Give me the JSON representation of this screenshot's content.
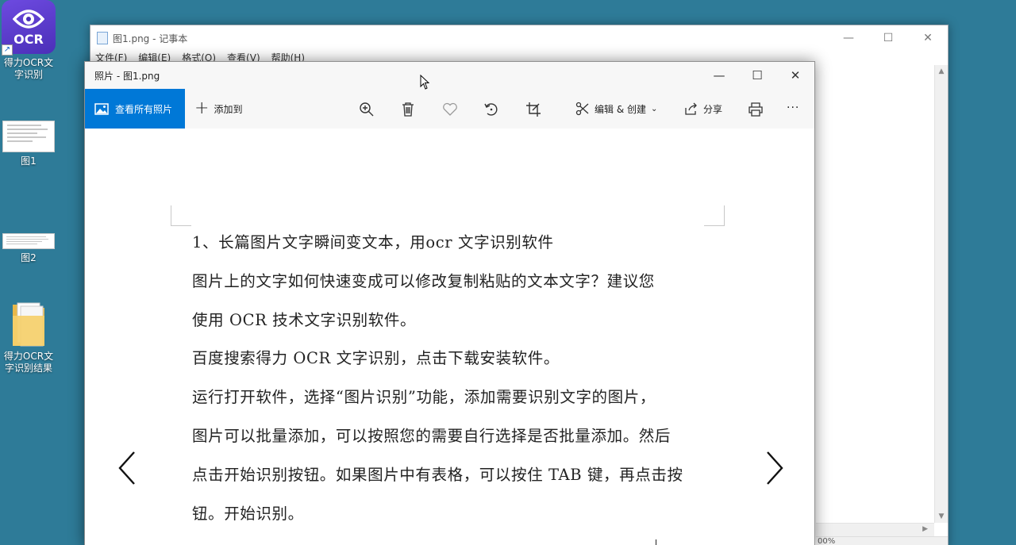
{
  "desktop": {
    "icons": [
      {
        "label_line1": "得力OCR文",
        "label_line2": "字识别",
        "badge": "OCR"
      },
      {
        "label": "图1"
      },
      {
        "label": "图2"
      },
      {
        "label_line1": "得力OCR文",
        "label_line2": "字识别结果"
      }
    ]
  },
  "notepad": {
    "title": "图1.png - 记事本",
    "menu": [
      "文件(F)",
      "编辑(E)",
      "格式(O)",
      "查看(V)",
      "帮助(H)"
    ],
    "status_zoom": "00%"
  },
  "photos": {
    "title": "照片 - 图1.png",
    "toolbar": {
      "view_all": "查看所有照片",
      "add_to": "添加到",
      "edit_create": "编辑 & 创建",
      "share": "分享",
      "more": "···"
    },
    "document_lines": [
      "1、长篇图片文字瞬间变文本，用ocr 文字识别软件",
      "图片上的文字如何快速变成可以修改复制粘贴的文本文字？建议您",
      "使用 OCR 技术文字识别软件。",
      "百度搜索得力 OCR 文字识别，点击下载安装软件。",
      "运行打开软件，选择“图片识别”功能，添加需要识别文字的图片，",
      "图片可以批量添加，可以按照您的需要自行选择是否批量添加。然后",
      "点击开始识别按钮。如果图片中有表格，可以按住 TAB 键，再点击按",
      "钮。开始识别。"
    ]
  },
  "colors": {
    "desktop": "#2e7b98",
    "accent": "#0078d7",
    "ocr_icon": "#5a3bd0"
  }
}
